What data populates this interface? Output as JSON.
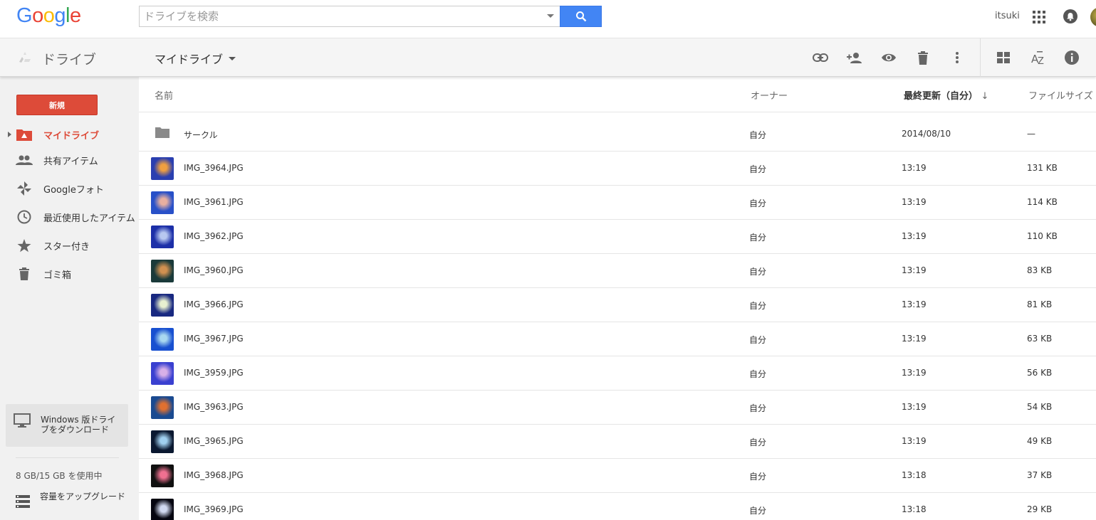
{
  "header": {
    "logo_letters": [
      {
        "ch": "G",
        "color": "#4285f4"
      },
      {
        "ch": "o",
        "color": "#ea4335"
      },
      {
        "ch": "o",
        "color": "#fbbc05"
      },
      {
        "ch": "g",
        "color": "#4285f4"
      },
      {
        "ch": "l",
        "color": "#34a853"
      },
      {
        "ch": "e",
        "color": "#ea4335"
      }
    ],
    "search_placeholder": "ドライブを検索",
    "user_name": "itsuki"
  },
  "subbar": {
    "app_title": "ドライブ",
    "breadcrumb": "マイドライブ",
    "toolbar_icons": [
      "link-icon",
      "add-person-icon",
      "preview-icon",
      "trash-icon",
      "more-icon",
      "grid-view-icon",
      "sort-az-icon",
      "info-icon"
    ]
  },
  "sidebar": {
    "new_label": "新規",
    "items": [
      {
        "label": "マイドライブ",
        "icon": "my-drive-icon",
        "active": true
      },
      {
        "label": "共有アイテム",
        "icon": "people-icon"
      },
      {
        "label": "Googleフォト",
        "icon": "pinwheel-icon"
      },
      {
        "label": "最近使用したアイテム",
        "icon": "clock-icon"
      },
      {
        "label": "スター付き",
        "icon": "star-icon"
      },
      {
        "label": "ゴミ箱",
        "icon": "trash-icon"
      }
    ],
    "download_label": "Windows 版ドライブをダウンロード",
    "storage_text": "8 GB/15 GB を使用中",
    "upgrade_label": "容量をアップグレード"
  },
  "list": {
    "columns": {
      "name": "名前",
      "owner": "オーナー",
      "modified": "最終更新（自分）",
      "size": "ファイルサイズ"
    },
    "sort_arrow": "↓",
    "rows": [
      {
        "name": "サークル",
        "owner": "自分",
        "modified": "2014/08/10",
        "size": "—",
        "type": "folder"
      },
      {
        "name": "IMG_3964.JPG",
        "owner": "自分",
        "modified": "13:19",
        "size": "131 KB",
        "thumb": [
          "#2a3fb0",
          "#f0a040"
        ]
      },
      {
        "name": "IMG_3961.JPG",
        "owner": "自分",
        "modified": "13:19",
        "size": "114 KB",
        "thumb": [
          "#2850c8",
          "#e8b0a0"
        ]
      },
      {
        "name": "IMG_3962.JPG",
        "owner": "自分",
        "modified": "13:19",
        "size": "110 KB",
        "thumb": [
          "#1c2fa8",
          "#b8c8f0"
        ]
      },
      {
        "name": "IMG_3960.JPG",
        "owner": "自分",
        "modified": "13:19",
        "size": "83 KB",
        "thumb": [
          "#1a3a3a",
          "#d09050"
        ]
      },
      {
        "name": "IMG_3966.JPG",
        "owner": "自分",
        "modified": "13:19",
        "size": "81 KB",
        "thumb": [
          "#182880",
          "#e8f0d0"
        ]
      },
      {
        "name": "IMG_3967.JPG",
        "owner": "自分",
        "modified": "13:19",
        "size": "63 KB",
        "thumb": [
          "#1850d0",
          "#a8d8f0"
        ]
      },
      {
        "name": "IMG_3959.JPG",
        "owner": "自分",
        "modified": "13:19",
        "size": "56 KB",
        "thumb": [
          "#3a40d0",
          "#d8b0e8"
        ]
      },
      {
        "name": "IMG_3963.JPG",
        "owner": "自分",
        "modified": "13:19",
        "size": "54 KB",
        "thumb": [
          "#1a4a90",
          "#e07030"
        ]
      },
      {
        "name": "IMG_3965.JPG",
        "owner": "自分",
        "modified": "13:19",
        "size": "49 KB",
        "thumb": [
          "#0a1830",
          "#a0d0f0"
        ]
      },
      {
        "name": "IMG_3968.JPG",
        "owner": "自分",
        "modified": "13:18",
        "size": "37 KB",
        "thumb": [
          "#101010",
          "#f07090"
        ]
      },
      {
        "name": "IMG_3969.JPG",
        "owner": "自分",
        "modified": "13:18",
        "size": "29 KB",
        "thumb": [
          "#050510",
          "#d0d8f0"
        ]
      }
    ]
  }
}
